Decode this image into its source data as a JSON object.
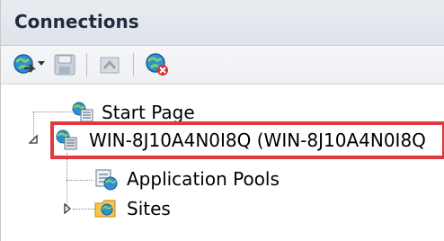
{
  "header": {
    "title": "Connections"
  },
  "toolbar": {
    "icons": [
      "connect-icon",
      "dropdown-arrow-icon",
      "save-icon",
      "up-folder-icon",
      "disconnect-icon"
    ]
  },
  "tree": {
    "items": [
      {
        "label": "Start Page",
        "icon": "start-page-icon"
      },
      {
        "label": "WIN-8J10A4N0I8Q (WIN-8J10A4N0I8Q",
        "icon": "server-icon",
        "state": "expanded"
      },
      {
        "label": "Application Pools",
        "icon": "app-pools-icon"
      },
      {
        "label": "Sites",
        "icon": "sites-folder-icon",
        "state": "collapsed"
      }
    ]
  },
  "colors": {
    "selection_border": "#e0393e",
    "header_bg": "#e4e7ed"
  }
}
